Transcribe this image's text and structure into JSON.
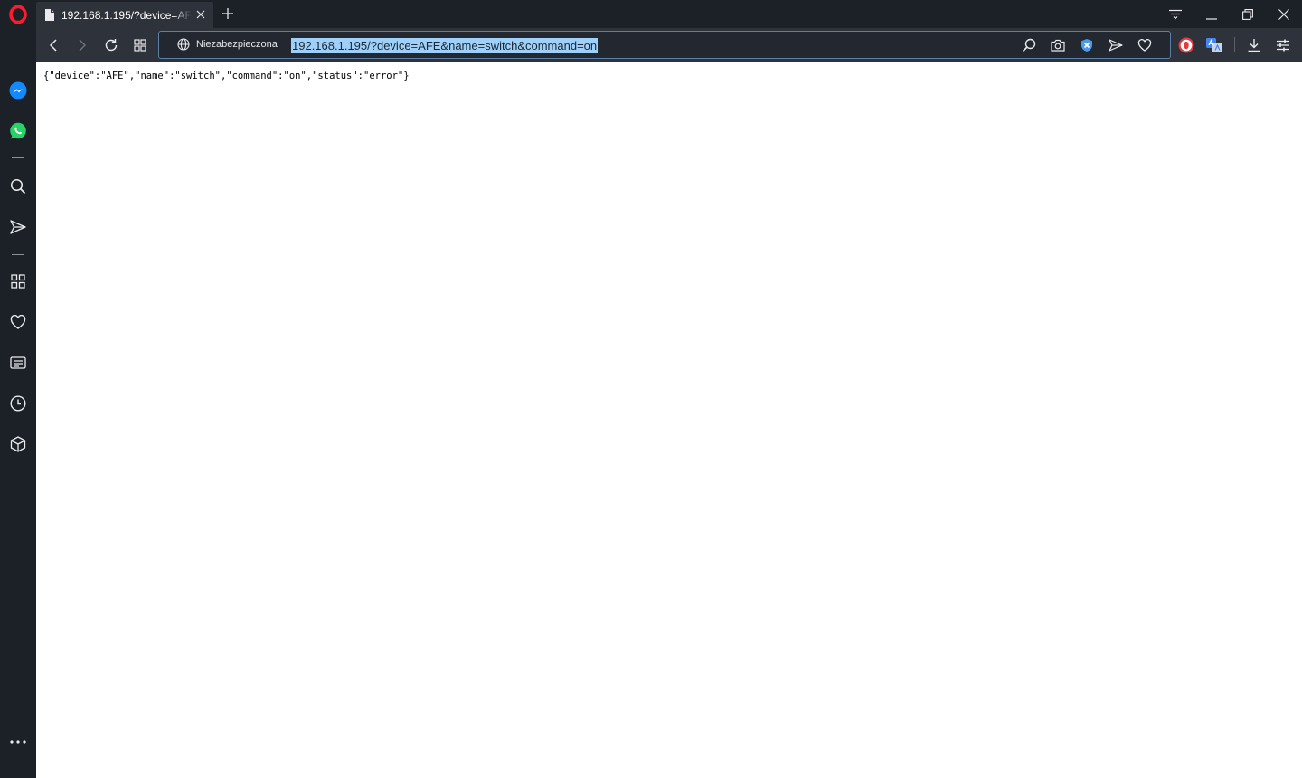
{
  "browser": {
    "accent_color": "#ff1b2d",
    "tab": {
      "title": "192.168.1.195/?device=AFE",
      "icon": "document-icon"
    },
    "addressbar": {
      "security_label": "Niezabezpieczona",
      "url": "192.168.1.195/?device=AFE&name=switch&command=on"
    }
  },
  "page": {
    "body_text": "{\"device\":\"AFE\",\"name\":\"switch\",\"command\":\"on\",\"status\":\"error\"}"
  }
}
